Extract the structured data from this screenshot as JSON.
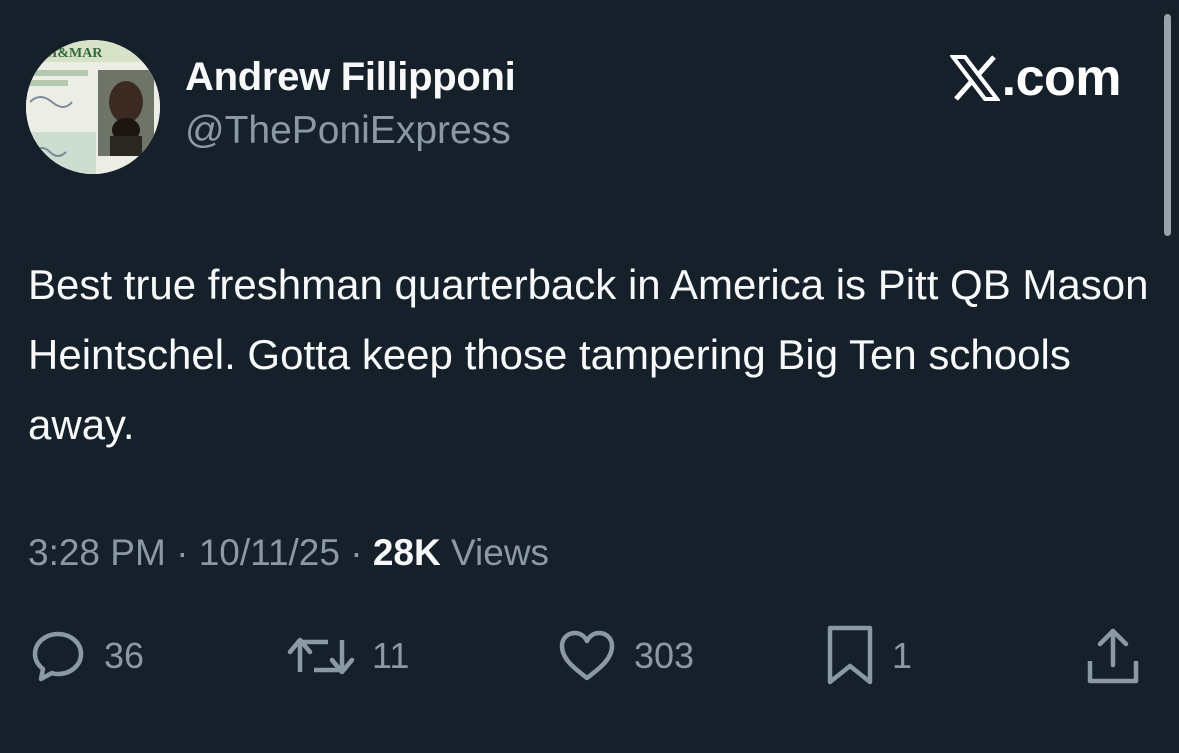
{
  "author": {
    "display_name": "Andrew Fillipponi",
    "handle": "@ThePoniExpress",
    "avatar_card_text": "AM&MAR"
  },
  "brand": {
    "label": ".com",
    "icon": "x-logo-icon"
  },
  "tweet": {
    "text": "Best true freshman quarterback in America is Pitt QB Mason Heintschel. Gotta keep those tampering Big Ten schools away."
  },
  "meta": {
    "time": "3:28 PM",
    "separator": " · ",
    "date": "10/11/25",
    "views_count": "28K",
    "views_label": " Views"
  },
  "actions": {
    "replies": {
      "icon": "reply-icon",
      "count": "36"
    },
    "reposts": {
      "icon": "repost-icon",
      "count": "11"
    },
    "likes": {
      "icon": "heart-icon",
      "count": "303"
    },
    "bookmarks": {
      "icon": "bookmark-icon",
      "count": "1"
    },
    "share": {
      "icon": "share-icon"
    }
  },
  "colors": {
    "background": "#15202b",
    "primary_text": "#f7f9f9",
    "secondary_text": "#8b98a5"
  }
}
